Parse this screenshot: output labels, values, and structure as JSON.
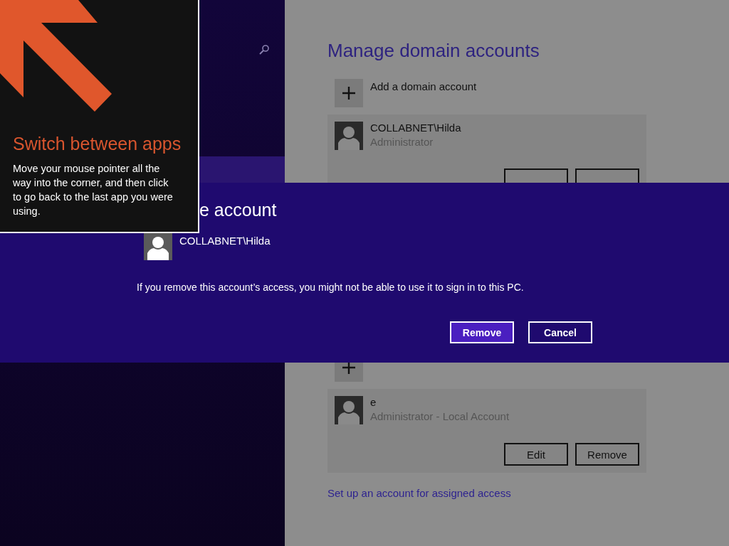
{
  "tip": {
    "title": "Switch between apps",
    "body": "Move your mouse pointer all the way into the corner, and then click to go back to the last app you were using."
  },
  "page": {
    "title": "Manage domain accounts",
    "add_domain": "Add a domain account",
    "domain_accounts": [
      {
        "name": "COLLABNET\\Hilda",
        "role": "Administrator"
      }
    ],
    "local_accounts": [
      {
        "name": "e",
        "role": "Administrator - Local Account",
        "buttons": [
          "Edit",
          "Remove"
        ]
      }
    ],
    "link": "Set up an account for assigned access"
  },
  "dialog": {
    "title": "e account",
    "account": "COLLABNET\\Hilda",
    "message": "If you remove this account’s access, you might not be able to use it to sign in to this PC.",
    "buttons": [
      {
        "label": "Remove",
        "kind": "primary"
      },
      {
        "label": "Cancel",
        "kind": "secondary"
      }
    ]
  }
}
